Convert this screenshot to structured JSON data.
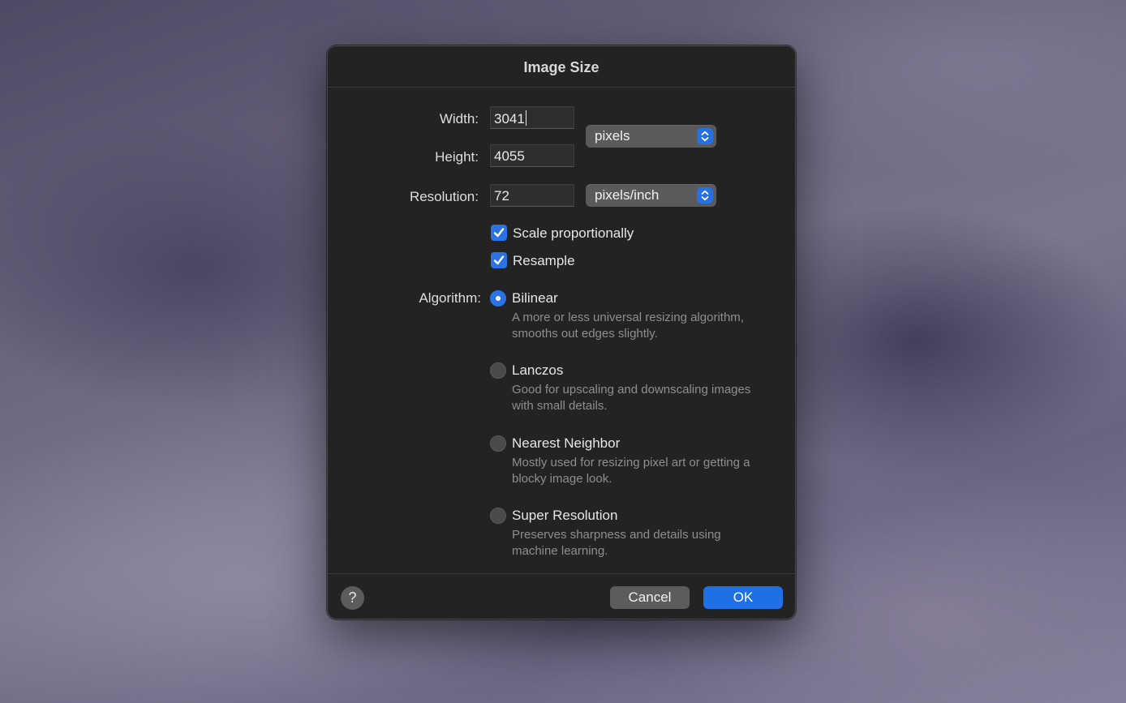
{
  "dialog": {
    "title": "Image Size",
    "width": {
      "label": "Width:",
      "value": "3041"
    },
    "height": {
      "label": "Height:",
      "value": "4055"
    },
    "resolution": {
      "label": "Resolution:",
      "value": "72"
    },
    "size_unit": {
      "selected": "pixels"
    },
    "resolution_unit": {
      "selected": "pixels/inch"
    },
    "scale_proportionally": {
      "label": "Scale proportionally",
      "checked": true
    },
    "resample": {
      "label": "Resample",
      "checked": true
    },
    "algorithm": {
      "label": "Algorithm:",
      "options": [
        {
          "name": "Bilinear",
          "description": "A more or less universal resizing algorithm, smooths out edges slightly.",
          "selected": true
        },
        {
          "name": "Lanczos",
          "description": "Good for upscaling and downscaling images with small details.",
          "selected": false
        },
        {
          "name": "Nearest Neighbor",
          "description": "Mostly used for resizing pixel art or getting a blocky image look.",
          "selected": false
        },
        {
          "name": "Super Resolution",
          "description": "Preserves sharpness and details using machine learning.",
          "selected": false
        }
      ]
    },
    "help_label": "?",
    "cancel_label": "Cancel",
    "ok_label": "OK"
  },
  "colors": {
    "accent": "#2b73e5",
    "dialog_bg": "#232324"
  },
  "icons": {
    "checkbox": "checkmark-icon",
    "select": "chevron-updown-icon"
  }
}
